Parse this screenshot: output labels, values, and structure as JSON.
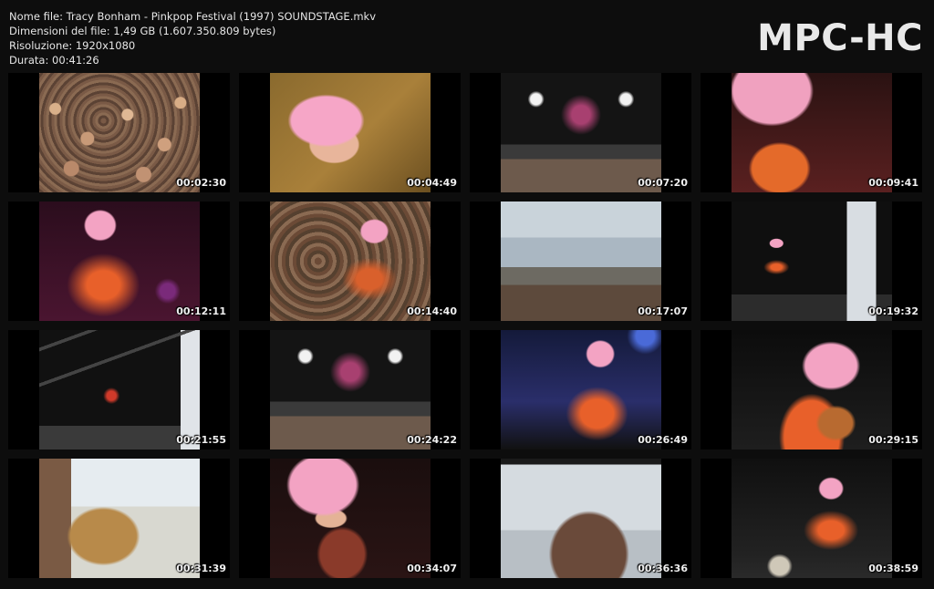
{
  "file_info": {
    "filename_line": "Nome file: Tracy Bonham - Pinkpop Festival (1997) SOUNDSTAGE.mkv",
    "size_line": "Dimensioni del file: 1,49 GB (1.607.350.809 bytes)",
    "resolution_line": "Risoluzione: 1920x1080",
    "duration_line": "Durata: 00:41:26"
  },
  "logo": "MPC-HC",
  "thumbnails": [
    {
      "timestamp": "00:02:30",
      "scene": "crowd"
    },
    {
      "timestamp": "00:04:49",
      "scene": "pink-close"
    },
    {
      "timestamp": "00:07:20",
      "scene": "stage-dark"
    },
    {
      "timestamp": "00:09:41",
      "scene": "pink-mic"
    },
    {
      "timestamp": "00:12:11",
      "scene": "orange-guitar"
    },
    {
      "timestamp": "00:14:40",
      "scene": "overlay-crowd"
    },
    {
      "timestamp": "00:17:07",
      "scene": "sky-stage"
    },
    {
      "timestamp": "00:19:32",
      "scene": "small-stage"
    },
    {
      "timestamp": "00:21:55",
      "scene": "truss"
    },
    {
      "timestamp": "00:24:22",
      "scene": "stage-dark"
    },
    {
      "timestamp": "00:26:49",
      "scene": "blue-stage"
    },
    {
      "timestamp": "00:29:15",
      "scene": "violin"
    },
    {
      "timestamp": "00:31:39",
      "scene": "guitar-close"
    },
    {
      "timestamp": "00:34:07",
      "scene": "violin-pink"
    },
    {
      "timestamp": "00:36:36",
      "scene": "sky-cymbal"
    },
    {
      "timestamp": "00:38:59",
      "scene": "violin-wide"
    }
  ]
}
